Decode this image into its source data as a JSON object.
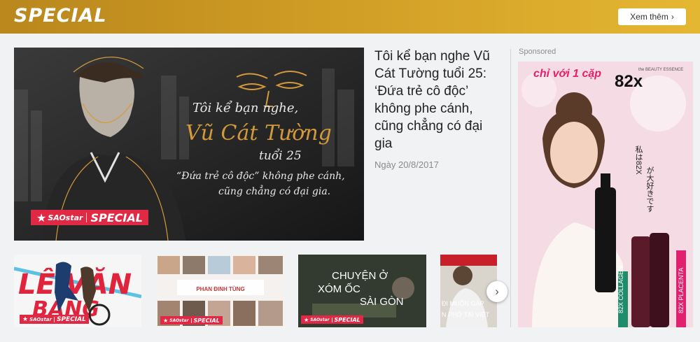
{
  "header": {
    "brand": "SPECIAL",
    "more_button": "Xem thêm"
  },
  "hero": {
    "title": "Tôi kể bạn nghe Vũ Cát Tường tuổi 25: ‘Đứa trẻ cô độc’ không phe cánh, cũng chẳng có đại gia",
    "date": "Ngày 20/8/2017",
    "image": {
      "line1": "Tôi kể bạn nghe,",
      "line2": "Vũ Cát Tường",
      "line3": "tuổi 25",
      "line4": "“Đứa trẻ cô độc” không phe cánh,",
      "line5": "cũng chẳng có đại gia.",
      "badge_brand": "SAOstar",
      "badge_label": "SPECIAL"
    }
  },
  "thumbnails": [
    {
      "caption": "LÊ VĂN",
      "caption2": "BẢNG",
      "badge_brand": "SAOstar",
      "badge_label": "SPECIAL"
    },
    {
      "caption": "PHAN ĐINH TÙNG",
      "badge_brand": "SAOstar",
      "badge_label": "SPECIAL"
    },
    {
      "caption": "CHUYỆN Ở",
      "caption2": "XÓM ỐC",
      "caption3": "SÀI GÒN",
      "badge_brand": "SAOstar",
      "badge_label": "SPECIAL"
    },
    {
      "caption": "ĐI MUỐN GẶP",
      "caption2": "N PHỞ TẠI VIỆT"
    }
  ],
  "ad": {
    "sponsored_label": "Sponsored",
    "headline": "chỉ với 1 cặp",
    "brand_small": "the BEAUTY ESSENCE",
    "brand_logo": "82x",
    "vertical_jp": "私は82X",
    "vertical_jp2": "が大好きです",
    "product1": "82X COLLAGEN",
    "product2": "82X PLACENTA"
  },
  "colors": {
    "header_gold": "#cf9c24",
    "badge_red": "#e02a45",
    "ad_pink": "#f6d8e2"
  }
}
